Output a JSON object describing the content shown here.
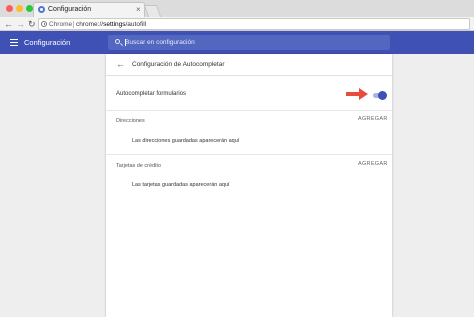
{
  "browser": {
    "tab_title": "Configuración",
    "tab_close": "×",
    "omnibox_chrome": "Chrome",
    "url_scheme": "chrome://",
    "url_host": "settings",
    "url_path": "/autofill"
  },
  "header": {
    "title": "Configuración",
    "search_placeholder": "Buscar en configuración"
  },
  "autofill": {
    "title": "Configuración de Autocompletar",
    "toggle_label": "Autocompletar formularios",
    "toggle_on": true,
    "addresses_label": "Direcciones",
    "addresses_action": "AGREGAR",
    "addresses_empty": "Las direcciones guardadas aparecerán aquí",
    "cards_label": "Tarjetas de crédito",
    "cards_action": "AGREGAR",
    "cards_empty": "Las tarjetas guardadas aparecerán aquí"
  },
  "colors": {
    "accent": "#3f51b5",
    "annotation_arrow": "#e74c3c"
  },
  "icons": {
    "back": "arrow-left-icon",
    "menu": "hamburger-menu-icon",
    "search": "search-icon"
  }
}
